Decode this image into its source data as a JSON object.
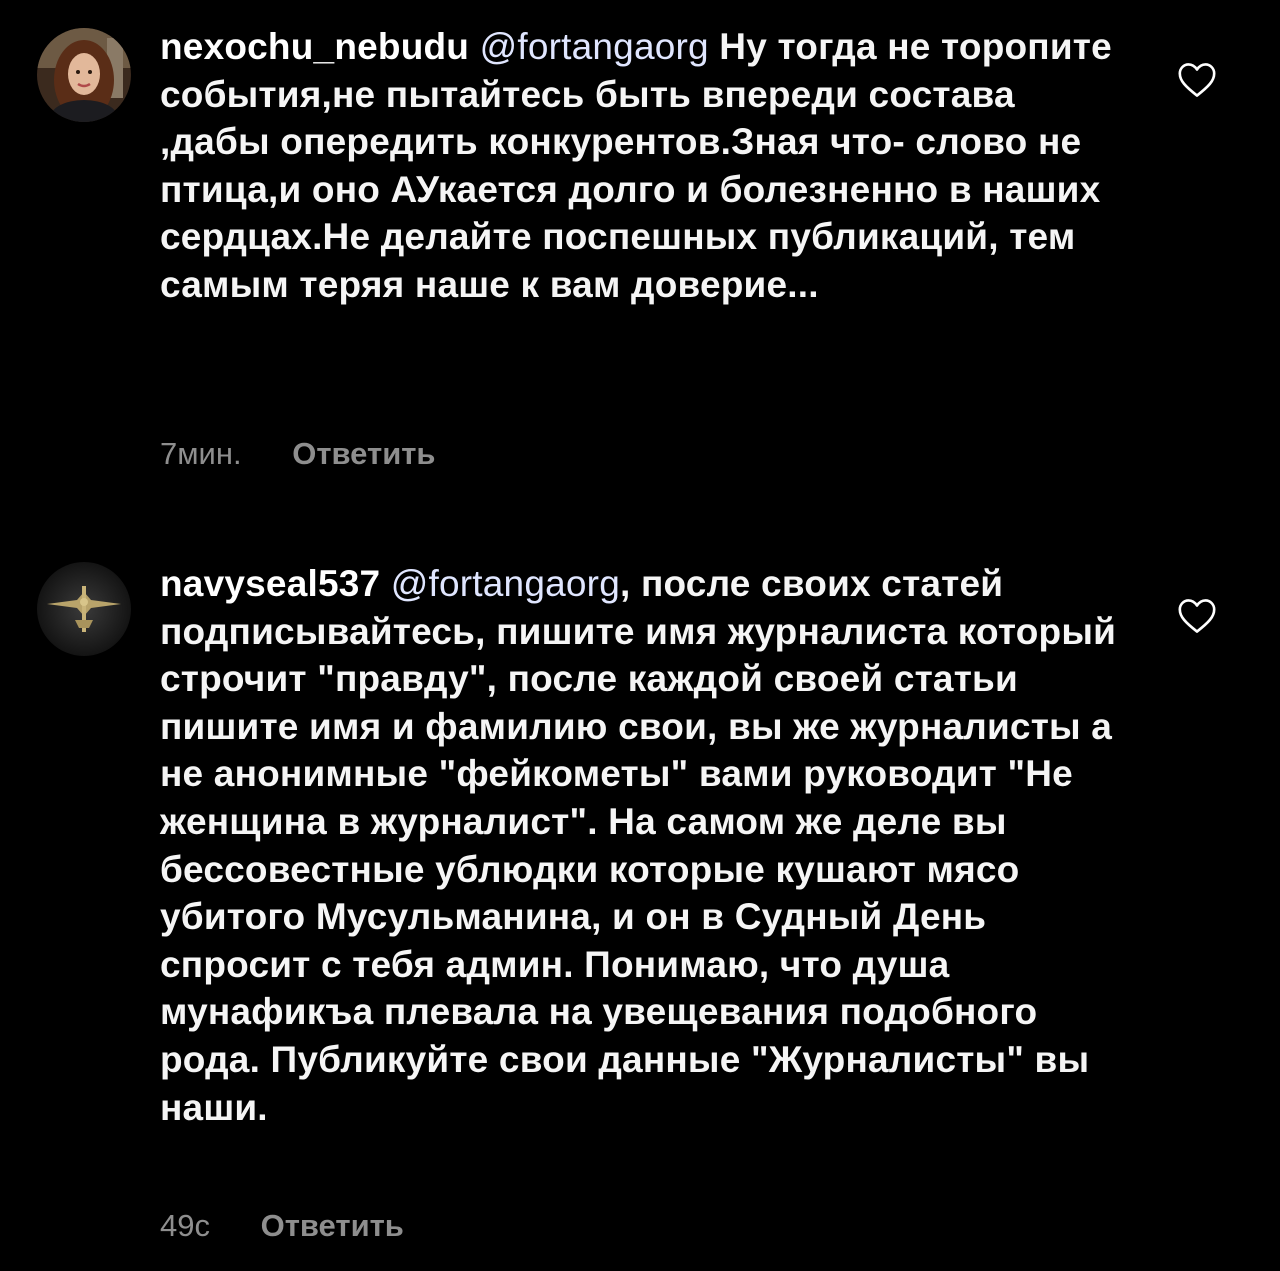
{
  "comments": [
    {
      "username": "nexochu_nebudu",
      "mention": "@fortangaorg",
      "text": " Ну тогда не торопите события,не пытайтесь быть впереди состава ,дабы опередить конкурентов.Зная что- слово не птица,и оно АУкается долго и болезненно в наших сердцах.Не делайте поспешных публикаций, тем самым теряя наше к вам доверие...",
      "time": "7мин.",
      "reply": "Ответить",
      "icon": "heart-outline-icon"
    },
    {
      "username": "navyseal537",
      "mention": "@fortangaorg",
      "text": ", после своих статей подписывайтесь, пишите имя журналиста который строчит \"правду\", после каждой своей статьи пишите имя и фамилию свои, вы же журналисты а не анонимные \"фейкометы\" вами руководит \"Не женщина в журналист\". На самом же деле вы бессовестные ублюдки которые кушают мясо убитого Мусульманина, и он в Судный День  спросит с тебя админ. Понимаю, что душа мунафикъа плевала на увещевания подобного рода. Публикуйте свои данные \"Журналисты\" вы наши.",
      "time": "49с",
      "reply": "Ответить",
      "icon": "heart-outline-icon"
    }
  ],
  "colors": {
    "background": "#000000",
    "text": "#f5f5f5",
    "secondary": "#8e8e8e",
    "mention": "#e0e6ff"
  }
}
